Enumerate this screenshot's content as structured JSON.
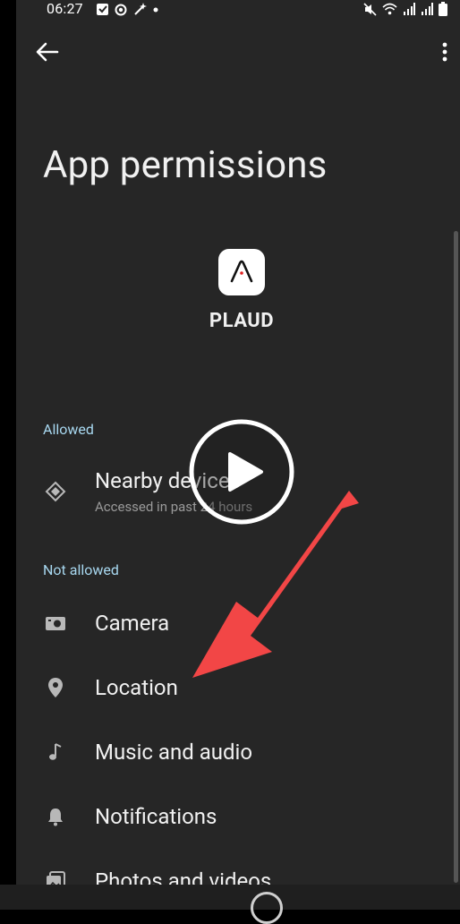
{
  "status_bar": {
    "time": "06:27",
    "left_icons": [
      "message-icon",
      "sync-icon",
      "magic-icon",
      "dot-icon"
    ],
    "right_icons": [
      "mute-icon",
      "wifi-icon",
      "signal-icon",
      "signal-icon",
      "battery-icon"
    ]
  },
  "app_bar": {
    "back_icon": "arrow-back-icon",
    "menu_icon": "more-vert-icon"
  },
  "page": {
    "title": "App permissions",
    "app_name": "PLAUD"
  },
  "sections": {
    "allowed": {
      "header": "Allowed",
      "items": [
        {
          "icon": "nearby-devices-icon",
          "label": "Nearby devices",
          "sublabel": "Accessed in past 24 hours"
        }
      ]
    },
    "not_allowed": {
      "header": "Not allowed",
      "items": [
        {
          "icon": "camera-icon",
          "label": "Camera"
        },
        {
          "icon": "location-icon",
          "label": "Location"
        },
        {
          "icon": "music-note-icon",
          "label": "Music and audio"
        },
        {
          "icon": "notifications-icon",
          "label": "Notifications"
        },
        {
          "icon": "photos-icon",
          "label": "Photos and videos"
        }
      ]
    }
  },
  "colors": {
    "background": "#262626",
    "section_header": "#a8d8f0",
    "arrow_annotation": "#f24646"
  }
}
